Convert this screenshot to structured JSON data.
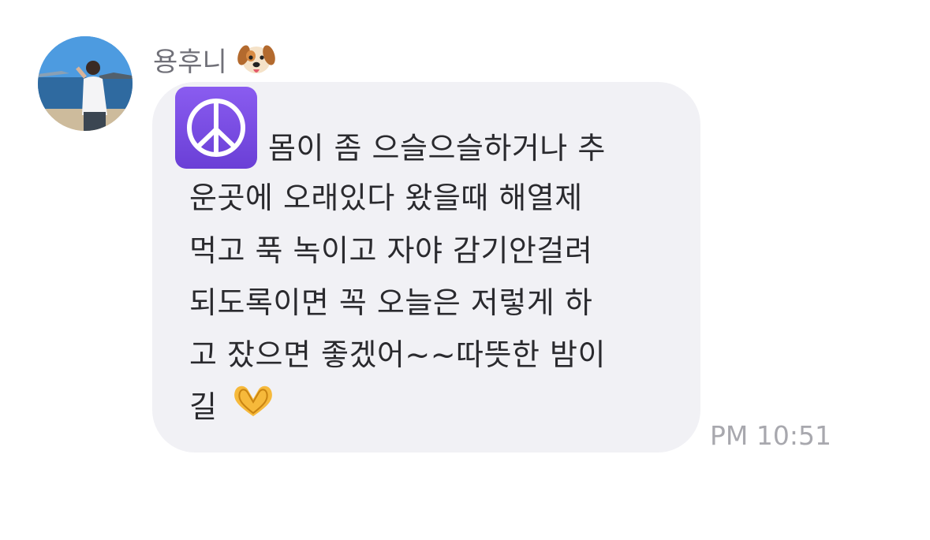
{
  "sender": {
    "name": "용후니",
    "name_emoji": "dog-face-icon"
  },
  "message": {
    "leading_emoji": "peace-symbol-icon",
    "lines": [
      "몸이 좀 으슬으슬하거나 추",
      "운곳에 오래있다 왔을때 해열제",
      "먹고 푹 녹이고 자야 감기안걸려",
      "되도록이면 꼭 오늘은 저렇게 하",
      "고 잤으면 좋겠어~~따뜻한 밤이",
      "길"
    ],
    "trailing_emoji": "heart-hands-icon",
    "timestamp": "PM 10:51"
  },
  "colors": {
    "bubble": "#f1f1f5",
    "text": "#2a2a2e",
    "sender_name": "#707078",
    "timestamp": "#a8a8ae",
    "peace_tile": "#7a4be6"
  }
}
